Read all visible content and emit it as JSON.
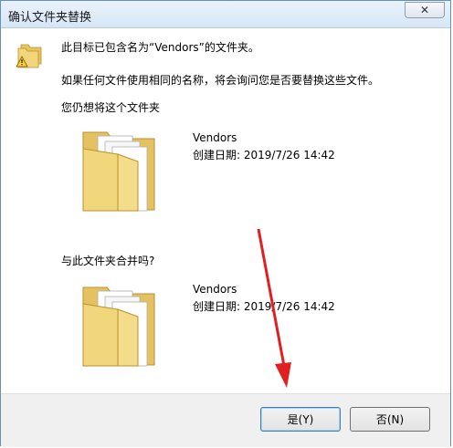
{
  "window": {
    "title": "确认文件夹替换"
  },
  "message": {
    "line1": "此目标已包含名为“Vendors”的文件夹。",
    "line2": "如果任何文件使用相同的名称，将会询问您是否要替换这些文件。",
    "prompt_keep": "您仍想将这个文件夹",
    "prompt_merge": "与此文件夹合并吗?"
  },
  "existing_folder": {
    "name": "Vendors",
    "date": "创建日期: 2019/7/26 14:42"
  },
  "source_folder": {
    "name": "Vendors",
    "date": "创建日期: 2019/7/26 14:42"
  },
  "buttons": {
    "yes": "是(Y)",
    "no": "否(N)",
    "close": "✕"
  },
  "colors": {
    "folder": "#f1d67b",
    "arrow": "#e02020",
    "title_bg": "#dce9f6"
  },
  "icons": [
    "warning-folder-icon",
    "folder-icon",
    "close-icon"
  ]
}
